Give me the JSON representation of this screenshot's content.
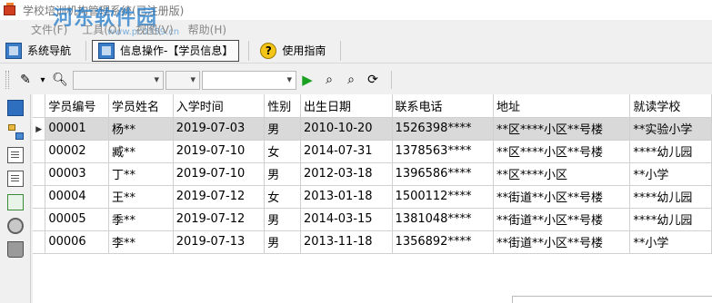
{
  "window": {
    "title": "学校培训机构管理系统(已注册版)",
    "watermark": "河东软件园",
    "watermark_url": "www.pc0359.cn"
  },
  "menu": {
    "items": [
      {
        "label": "文件(F)"
      },
      {
        "label": "工具(O)"
      },
      {
        "label": "视图(V)"
      },
      {
        "label": "帮助(H)"
      }
    ]
  },
  "nav": {
    "system_nav": "系统导航",
    "info_ops": "信息操作-【学员信息】",
    "user_guide": "使用指南"
  },
  "toolbar": {
    "combo1_value": "",
    "combo2_value": "",
    "combo3_value": ""
  },
  "table": {
    "columns": [
      "学员编号",
      "学员姓名",
      "入学时间",
      "性别",
      "出生日期",
      "联系电话",
      "地址",
      "就读学校"
    ],
    "rows": [
      [
        "00001",
        "杨**",
        "2019-07-03",
        "男",
        "2010-10-20",
        "1526398****",
        "**区****小区**号楼",
        "**实验小学"
      ],
      [
        "00002",
        "臧**",
        "2019-07-10",
        "女",
        "2014-07-31",
        "1378563****",
        "**区****小区**号楼",
        "****幼儿园"
      ],
      [
        "00003",
        "丁**",
        "2019-07-10",
        "男",
        "2012-03-18",
        "1396586****",
        "**区****小区",
        "**小学"
      ],
      [
        "00004",
        "王**",
        "2019-07-12",
        "女",
        "2013-01-18",
        "1500112****",
        "**街道**小区**号楼",
        "****幼儿园"
      ],
      [
        "00005",
        "季**",
        "2019-07-12",
        "男",
        "2014-03-15",
        "1381048****",
        "**街道**小区**号楼",
        "****幼儿园"
      ],
      [
        "00006",
        "李**",
        "2019-07-13",
        "男",
        "2013-11-18",
        "1356892****",
        "**街道**小区**号楼",
        "**小学"
      ]
    ],
    "selected_row": 0
  }
}
